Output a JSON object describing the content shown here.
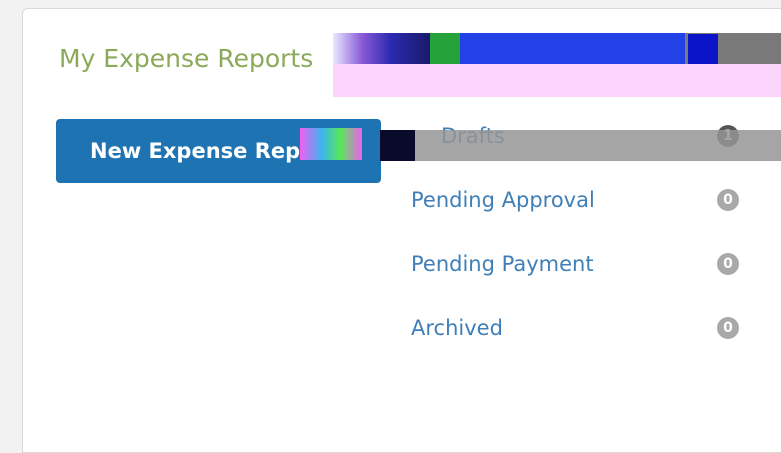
{
  "header": {
    "title": "My Expense Reports"
  },
  "actions": {
    "new_report_label": "New Expense Report"
  },
  "status_list": [
    {
      "label": "Drafts",
      "count": "1",
      "badge_color": "#555555"
    },
    {
      "label": "Pending Approval",
      "count": "0",
      "badge_color": "#a9a9a9"
    },
    {
      "label": "Pending Payment",
      "count": "0",
      "badge_color": "#a9a9a9"
    },
    {
      "label": "Archived",
      "count": "0",
      "badge_color": "#a9a9a9"
    }
  ],
  "colors": {
    "title": "#8aaa5a",
    "primary_button": "#1e74b2",
    "link": "#3f7fb7",
    "badge": "#a9a9a9"
  }
}
